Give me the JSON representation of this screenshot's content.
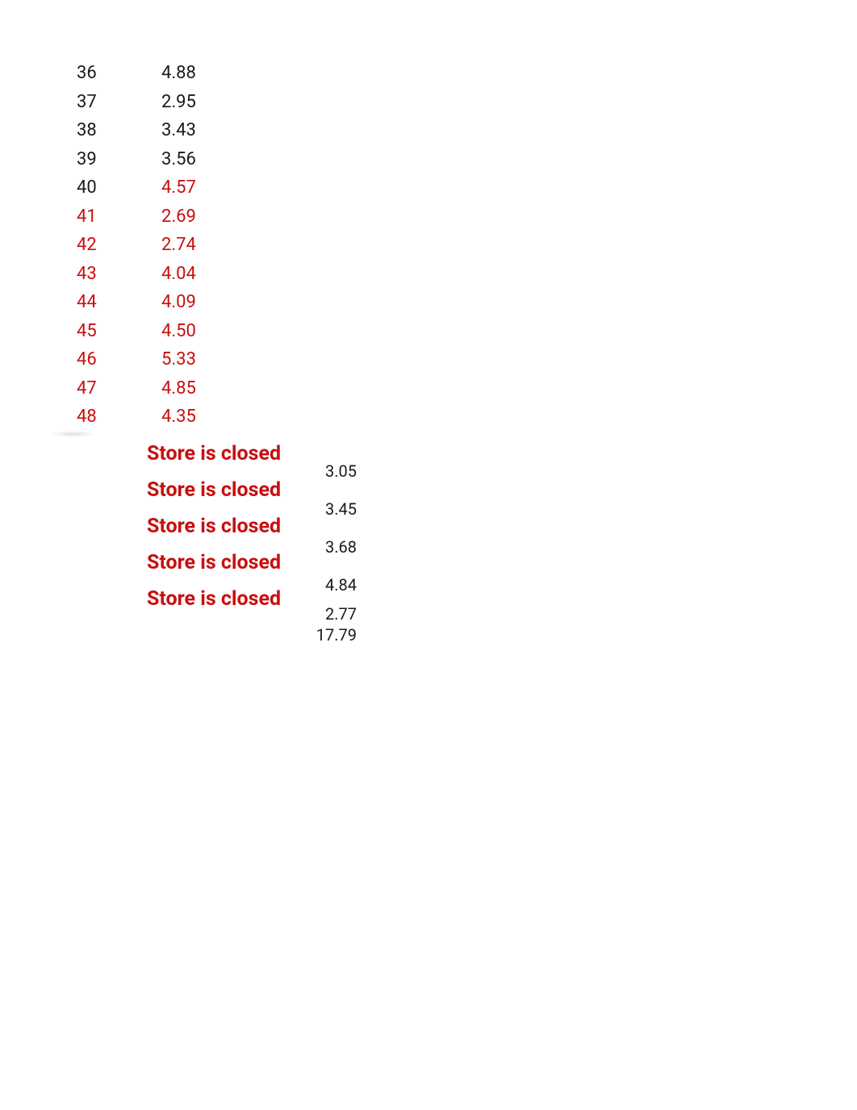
{
  "rows": [
    {
      "index": "36",
      "value": "4.88",
      "indexColor": "black",
      "valueColor": "black"
    },
    {
      "index": "37",
      "value": "2.95",
      "indexColor": "black",
      "valueColor": "black"
    },
    {
      "index": "38",
      "value": "3.43",
      "indexColor": "black",
      "valueColor": "black"
    },
    {
      "index": "39",
      "value": "3.56",
      "indexColor": "black",
      "valueColor": "black"
    },
    {
      "index": "40",
      "value": "4.57",
      "indexColor": "black",
      "valueColor": "red"
    },
    {
      "index": "41",
      "value": "2.69",
      "indexColor": "red",
      "valueColor": "red"
    },
    {
      "index": "42",
      "value": "2.74",
      "indexColor": "red",
      "valueColor": "red"
    },
    {
      "index": "43",
      "value": "4.04",
      "indexColor": "red",
      "valueColor": "red"
    },
    {
      "index": "44",
      "value": "4.09",
      "indexColor": "red",
      "valueColor": "red"
    },
    {
      "index": "45",
      "value": "4.50",
      "indexColor": "red",
      "valueColor": "red"
    },
    {
      "index": "46",
      "value": "5.33",
      "indexColor": "red",
      "valueColor": "red"
    },
    {
      "index": "47",
      "value": "4.85",
      "indexColor": "red",
      "valueColor": "red"
    },
    {
      "index": "48",
      "value": "4.35",
      "indexColor": "red",
      "valueColor": "red"
    }
  ],
  "closed": [
    "Store is closed",
    "Store is closed",
    "Store is closed",
    "Store is closed",
    "Store is closed"
  ],
  "rightValues": [
    {
      "text": "3.05",
      "tight": false
    },
    {
      "text": "3.45",
      "tight": false
    },
    {
      "text": "3.68",
      "tight": false
    },
    {
      "text": "4.84",
      "tight": false
    },
    {
      "text": "2.77",
      "tight": true
    },
    {
      "text": "17.79",
      "tight": true
    }
  ]
}
